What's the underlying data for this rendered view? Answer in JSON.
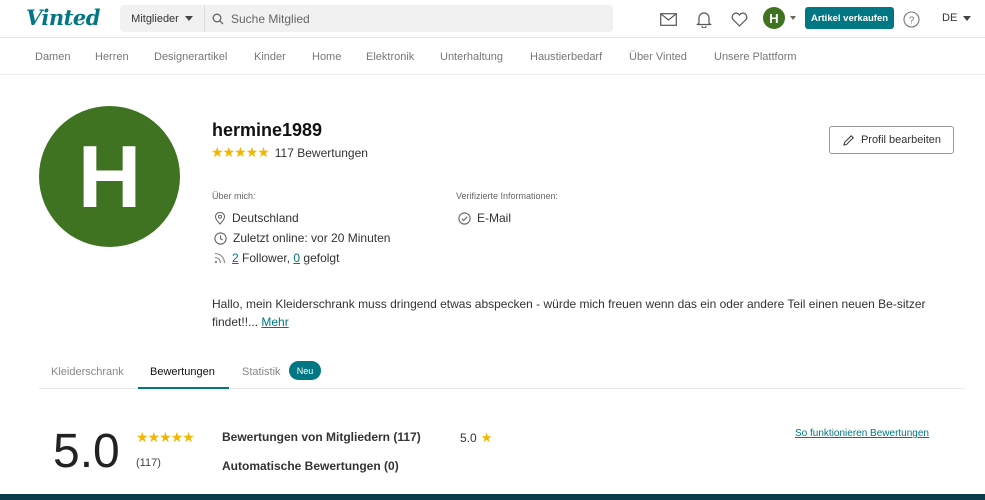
{
  "header": {
    "logo": "Vinted",
    "search_category": "Mitglieder",
    "search_placeholder": "Suche Mitglied",
    "user_initial": "H",
    "sell_button": "Artikel verkaufen",
    "language": "DE",
    "icons": [
      "mail-icon",
      "bell-icon",
      "heart-icon",
      "help-icon"
    ]
  },
  "categories": [
    "Damen",
    "Herren",
    "Designerartikel",
    "Kinder",
    "Home",
    "Elektronik",
    "Unterhaltung",
    "Haustierbedarf",
    "Über Vinted",
    "Unsere Plattform"
  ],
  "profile": {
    "initial": "H",
    "username": "hermine1989",
    "stars": "★★★★★",
    "review_count": "117 Bewertungen",
    "edit_button": "Profil bearbeiten",
    "about_label": "Über mich:",
    "location": "Deutschland",
    "last_online": "Zuletzt online: vor 20 Minuten",
    "followers_count": "2",
    "followers_label": " Follower, ",
    "following_count": "0",
    "following_label": " gefolgt",
    "verified_label": "Verifizierte Informationen:",
    "verified_email": "E-Mail",
    "bio": "Hallo, mein Kleiderschrank muss dringend etwas abspecken - würde mich freuen wenn das ein oder andere Teil einen neuen Be-sitzer findet!!...",
    "more_link": "Mehr"
  },
  "tabs": {
    "items": [
      "Kleiderschrank",
      "Bewertungen",
      "Statistik"
    ],
    "active": "Bewertungen",
    "new_badge": "Neu"
  },
  "ratings": {
    "score": "5.0",
    "stars": "★★★★★",
    "count": "(117)",
    "member_reviews": "Bewertungen von Mitgliedern (117)",
    "member_score": "5.0",
    "automatic_reviews": "Automatische Bewertungen (0)",
    "how_link": "So funktionieren Bewertungen"
  },
  "colors": {
    "brand": "#007782",
    "avatar": "#3f7321",
    "star": "#f2b600"
  }
}
